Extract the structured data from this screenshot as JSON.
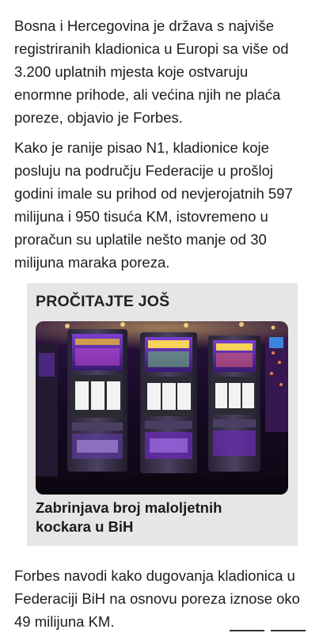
{
  "article": {
    "paragraph_1": "Bosna i Hercegovina je država s najviše registriranih kladionica u Europi sa više od 3.200 uplatnih mjesta koje ostvaruju enormne prihode, ali većina njih ne plaća poreze, objavio je Forbes.",
    "paragraph_2": "Kako je ranije pisao N1, kladionice koje posluju na području Federacije u prošloj godini imale su prihod od nevjerojatnih 597 milijuna i 950 tisuća KM, istovremeno u proračun su uplatile nešto manje od 30 milijuna maraka poreza.",
    "paragraph_3": "Forbes navodi kako dugovanja kladionica u Federaciji BiH na osnovu poreza iznose oko 49 milijuna KM."
  },
  "read_more": {
    "heading": "PROČITAJTE JOŠ",
    "title": "Zabrinjava broj maloljetnih kockara u BiH",
    "image_subject": "slot-machines-photo",
    "machine_labels": [
      "TRIPLE DOUBLE",
      "TRIPLE DOUBLE",
      "TRIPLE DOUBLE"
    ]
  },
  "colors": {
    "box_background": "#e6e6e6",
    "text": "#1c1c1c",
    "image_dark": "#1a0d2e",
    "image_purple": "#6a2bb5",
    "image_gold": "#e8b431"
  }
}
